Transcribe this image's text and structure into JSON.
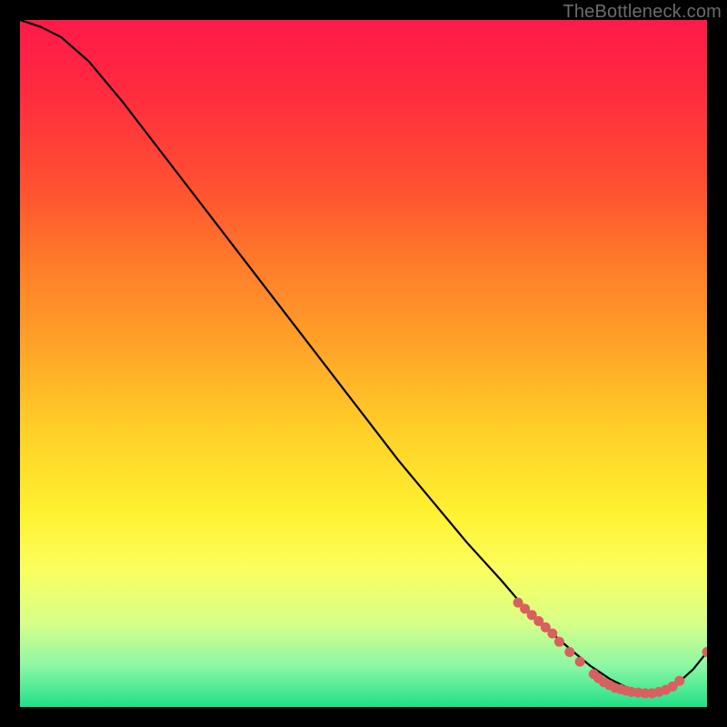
{
  "attribution": "TheBottleneck.com",
  "chart_data": {
    "type": "line",
    "title": "",
    "xlabel": "",
    "ylabel": "",
    "xlim": [
      0,
      100
    ],
    "ylim": [
      0,
      100
    ],
    "series": [
      {
        "name": "curve",
        "x": [
          0,
          3,
          6,
          10,
          15,
          20,
          25,
          30,
          35,
          40,
          45,
          50,
          55,
          60,
          65,
          70,
          73,
          76,
          80,
          83,
          86,
          89,
          92,
          95,
          98,
          100
        ],
        "y": [
          100,
          99,
          97.5,
          94,
          88,
          81.5,
          75,
          68.5,
          62,
          55.5,
          49,
          42.5,
          36,
          30,
          24,
          18.5,
          15,
          12,
          8.5,
          6,
          4,
          2.5,
          2,
          2.8,
          5.5,
          8
        ]
      }
    ],
    "markers": [
      {
        "x": 72.5,
        "y": 15.2
      },
      {
        "x": 73.5,
        "y": 14.3
      },
      {
        "x": 74.5,
        "y": 13.4
      },
      {
        "x": 75.5,
        "y": 12.5
      },
      {
        "x": 76.5,
        "y": 11.6
      },
      {
        "x": 77.5,
        "y": 10.7
      },
      {
        "x": 78.5,
        "y": 9.5
      },
      {
        "x": 80.0,
        "y": 8.0
      },
      {
        "x": 81.5,
        "y": 6.6
      },
      {
        "x": 83.5,
        "y": 4.8
      },
      {
        "x": 84.2,
        "y": 4.2
      },
      {
        "x": 85.0,
        "y": 3.6
      },
      {
        "x": 85.8,
        "y": 3.2
      },
      {
        "x": 86.6,
        "y": 2.8
      },
      {
        "x": 87.4,
        "y": 2.6
      },
      {
        "x": 88.2,
        "y": 2.4
      },
      {
        "x": 89.0,
        "y": 2.2
      },
      {
        "x": 90.0,
        "y": 2.1
      },
      {
        "x": 91.0,
        "y": 2.0
      },
      {
        "x": 92.0,
        "y": 2.0
      },
      {
        "x": 93.0,
        "y": 2.2
      },
      {
        "x": 94.0,
        "y": 2.5
      },
      {
        "x": 95.0,
        "y": 3.0
      },
      {
        "x": 96.0,
        "y": 3.8
      },
      {
        "x": 100.0,
        "y": 8.0
      }
    ],
    "marker_color": "#d9605e",
    "curve_color": "#000000"
  }
}
